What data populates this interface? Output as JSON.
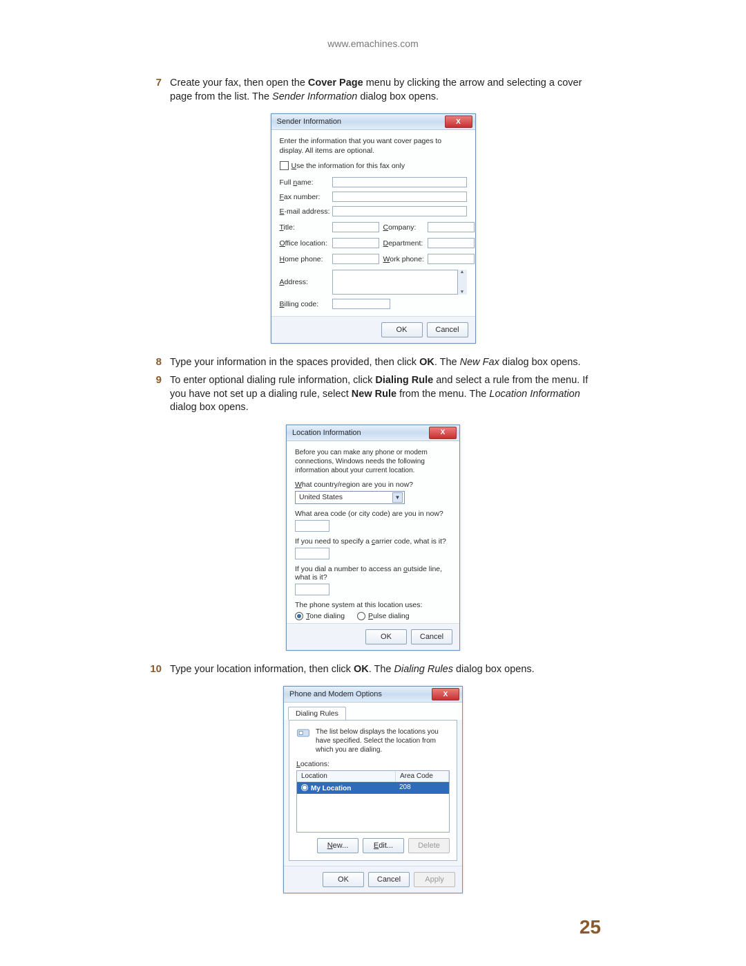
{
  "header_url": "www.emachines.com",
  "page_number": "25",
  "steps": {
    "s7_num": "7",
    "s7_a": "Create your fax, then open the ",
    "s7_b": "Cover Page",
    "s7_c": " menu by clicking the arrow and selecting a cover page from the list. The ",
    "s7_d": "Sender Information",
    "s7_e": " dialog box opens.",
    "s8_num": "8",
    "s8_a": "Type your information in the spaces provided, then click ",
    "s8_b": "OK",
    "s8_c": ". The ",
    "s8_d": "New Fax",
    "s8_e": " dialog box opens.",
    "s9_num": "9",
    "s9_a": "To enter optional dialing rule information, click ",
    "s9_b": "Dialing Rule",
    "s9_c": " and select a rule from the menu. If you have not set up a dialing rule, select ",
    "s9_d": "New Rule",
    "s9_e": " from the menu. The ",
    "s9_f": "Location Information",
    "s9_g": " dialog box opens.",
    "s10_num": "10",
    "s10_a": "Type your location information, then click ",
    "s10_b": "OK",
    "s10_c": ". The ",
    "s10_d": "Dialing Rules",
    "s10_e": " dialog box opens."
  },
  "btn": {
    "ok": "OK",
    "cancel": "Cancel",
    "new": "New...",
    "edit": "Edit...",
    "delete": "Delete",
    "apply": "Apply",
    "close_x": "X"
  },
  "dlg1": {
    "title": "Sender Information",
    "intro": "Enter the information that you want cover pages to display. All items are optional.",
    "checkbox": "Use the information for this fax only",
    "full_name": "Full name:",
    "fax_number": "Fax number:",
    "email": "E-mail address:",
    "title_lbl": "Title:",
    "company": "Company:",
    "office": "Office location:",
    "department": "Department:",
    "home_phone": "Home phone:",
    "work_phone": "Work phone:",
    "address": "Address:",
    "billing": "Billing code:"
  },
  "dlg2": {
    "title": "Location Information",
    "intro": "Before you can make any phone or modem connections, Windows needs the following information about your current location.",
    "q_country": "What country/region are you in now?",
    "country_value": "United States",
    "q_area": "What area code (or city code) are you in now?",
    "q_carrier": "If you need to specify a carrier code, what is it?",
    "q_outside": "If you dial a number to access an outside line, what is it?",
    "q_system": "The phone system at this location uses:",
    "tone": "Tone dialing",
    "pulse": "Pulse dialing"
  },
  "dlg3": {
    "title": "Phone and Modem Options",
    "tab": "Dialing Rules",
    "intro": "The list below displays the locations you have specified. Select the location from which you are dialing.",
    "locations_lbl": "Locations:",
    "col_location": "Location",
    "col_area": "Area Code",
    "row_location": "My Location",
    "row_area": "208"
  }
}
